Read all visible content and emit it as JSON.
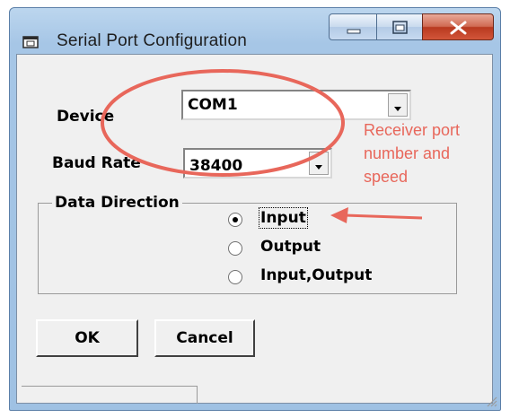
{
  "window": {
    "title": "Serial Port Configuration",
    "icons": {
      "app": "app-window-icon",
      "minimize": "minimize-icon",
      "maximize": "maximize-icon",
      "close": "close-icon"
    }
  },
  "form": {
    "device_label": "Device",
    "device_value": "COM1",
    "baud_label": "Baud Rate",
    "baud_value": "38400",
    "group_title": "Data Direction",
    "options": [
      "Input",
      "Output",
      "Input,Output"
    ],
    "selected_option": "Input"
  },
  "buttons": {
    "ok": "OK",
    "cancel": "Cancel"
  },
  "annotation": {
    "lines": [
      "Receiver port",
      "number and",
      "speed"
    ],
    "color": "#e8675b"
  }
}
